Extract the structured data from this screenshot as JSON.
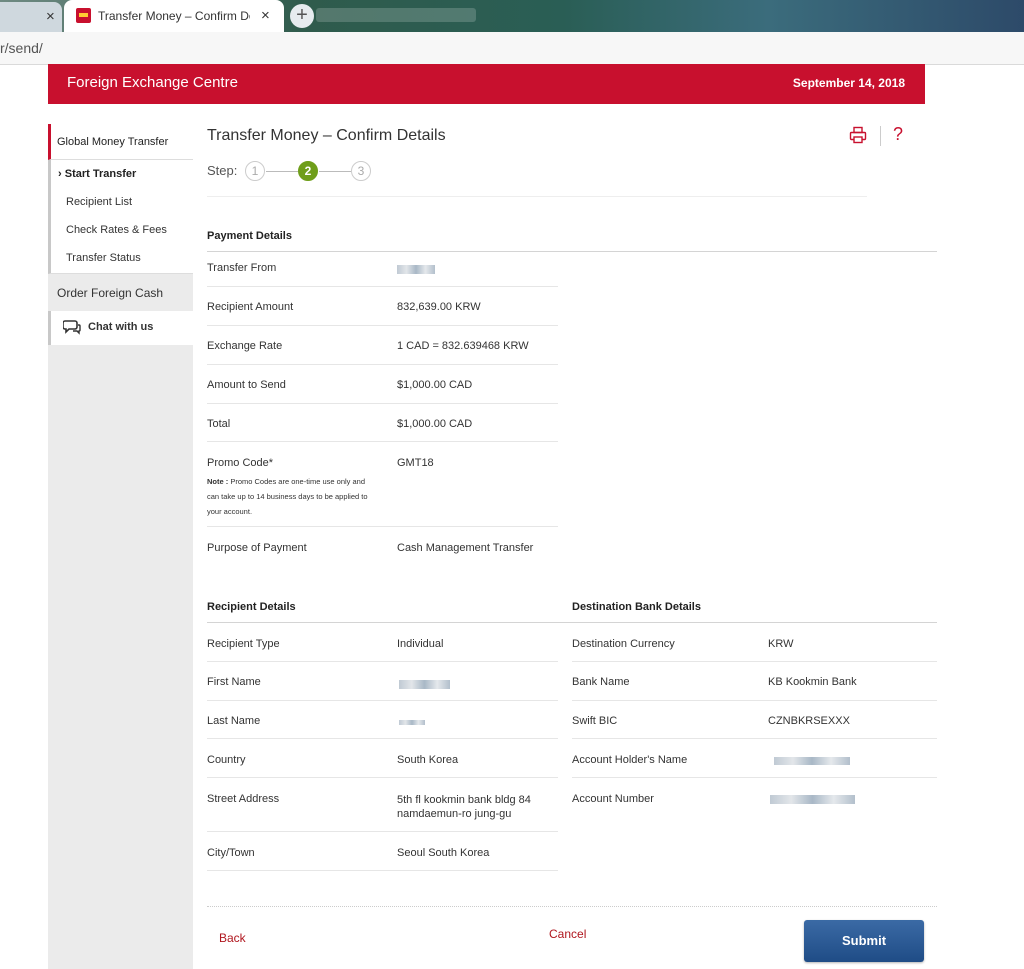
{
  "browser": {
    "active_tab_title": "Transfer Money – Confirm Details",
    "url_fragment": "r/send/",
    "new_tab_symbol": "+",
    "close_symbol": "×"
  },
  "header": {
    "brand": "Foreign Exchange Centre",
    "date": "September 14, 2018",
    "color": "#c8102e"
  },
  "sidebar": {
    "main_item": "Global Money Transfer",
    "sub_items": [
      "Start Transfer",
      "Recipient List",
      "Check Rates & Fees",
      "Transfer Status"
    ],
    "active_marker": "›",
    "foreign_cash": "Order Foreign Cash",
    "chat": "Chat with us"
  },
  "main": {
    "title": "Transfer Money – Confirm Details",
    "step_label": "Step:",
    "steps": [
      "1",
      "2",
      "3"
    ],
    "current_step": "2",
    "help_symbol": "?"
  },
  "payment": {
    "title": "Payment Details",
    "rows": [
      {
        "label": "Transfer From",
        "value": ""
      },
      {
        "label": "Recipient Amount",
        "value": "832,639.00 KRW"
      },
      {
        "label": "Exchange Rate",
        "value": "1 CAD = 832.639468 KRW"
      },
      {
        "label": "Amount to Send",
        "value": "$1,000.00 CAD"
      },
      {
        "label": "Total",
        "value": "$1,000.00 CAD"
      },
      {
        "label": "Promo Code*",
        "value": "GMT18"
      },
      {
        "label": "Purpose of Payment",
        "value": "Cash Management Transfer"
      }
    ],
    "note_prefix": "Note :",
    "note_text": "Promo Codes are one-time use only and can take up to 14 business days to be applied to your account."
  },
  "recipient": {
    "title": "Recipient Details",
    "rows": [
      {
        "label": "Recipient Type",
        "value": "Individual"
      },
      {
        "label": "First Name",
        "value": ""
      },
      {
        "label": "Last Name",
        "value": ""
      },
      {
        "label": "Country",
        "value": "South Korea"
      },
      {
        "label": "Street Address",
        "value": "5th fl kookmin bank bldg 84 namdaemun-ro jung-gu"
      },
      {
        "label": "City/Town",
        "value": "Seoul South Korea"
      }
    ]
  },
  "destination": {
    "title": "Destination Bank Details",
    "rows": [
      {
        "label": "Destination Currency",
        "value": "KRW"
      },
      {
        "label": "Bank Name",
        "value": "KB Kookmin Bank"
      },
      {
        "label": "Swift BIC",
        "value": "CZNBKRSEXXX"
      },
      {
        "label": "Account Holder's Name",
        "value": ""
      },
      {
        "label": "Account Number",
        "value": ""
      }
    ]
  },
  "actions": {
    "back": "Back",
    "cancel": "Cancel",
    "submit": "Submit"
  }
}
